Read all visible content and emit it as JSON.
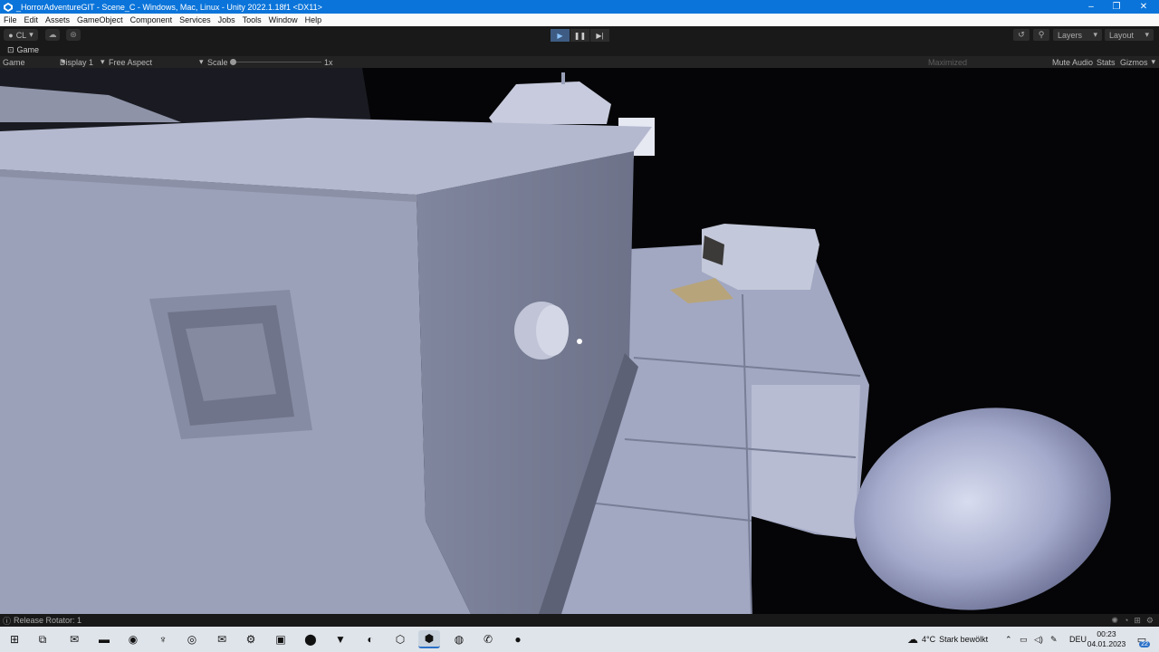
{
  "window": {
    "title": "_HorrorAdventureGIT - Scene_C - Windows, Mac, Linux - Unity 2022.1.18f1 <DX11>",
    "minimize": "–",
    "maximize": "❐",
    "close": "✕"
  },
  "menu": [
    "File",
    "Edit",
    "Assets",
    "GameObject",
    "Component",
    "Services",
    "Jobs",
    "Tools",
    "Window",
    "Help"
  ],
  "toolbar": {
    "account_label": "CL",
    "layers_label": "Layers",
    "layout_label": "Layout",
    "play_state": "playing"
  },
  "game_tab": {
    "label": "Game"
  },
  "game_header": {
    "view_label": "Game",
    "display": "Display 1",
    "aspect": "Free Aspect",
    "scale_label": "Scale",
    "scale_value": "1x",
    "maximized": "Maximized",
    "mute_audio": "Mute Audio",
    "stats": "Stats",
    "gizmos": "Gizmos"
  },
  "status": {
    "message": "Release Rotator: 1"
  },
  "taskbar": {
    "weather_temp": "4°C",
    "weather_text": "Stark bewölkt",
    "language": "DEU",
    "time": "00:23",
    "date": "04.01.2023",
    "notification_count": "22"
  },
  "colors": {
    "titlebar": "#0a74da",
    "editor_bg": "#191919",
    "play_active": "#3e5c83",
    "taskbar": "#dfe4ea"
  }
}
